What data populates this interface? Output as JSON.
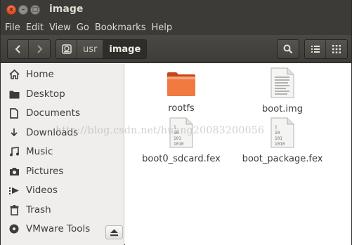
{
  "window": {
    "title": "image"
  },
  "menu": [
    "File",
    "Edit",
    "View",
    "Go",
    "Bookmarks",
    "Help"
  ],
  "breadcrumb": {
    "parent": "usr",
    "current": "image"
  },
  "sidebar": {
    "items": [
      {
        "label": "Home",
        "icon": "home-icon"
      },
      {
        "label": "Desktop",
        "icon": "folder-icon"
      },
      {
        "label": "Documents",
        "icon": "document-icon"
      },
      {
        "label": "Downloads",
        "icon": "download-icon"
      },
      {
        "label": "Music",
        "icon": "music-icon"
      },
      {
        "label": "Pictures",
        "icon": "camera-icon"
      },
      {
        "label": "Videos",
        "icon": "video-icon"
      },
      {
        "label": "Trash",
        "icon": "trash-icon"
      },
      {
        "label": "VMware Tools",
        "icon": "disc-icon"
      }
    ]
  },
  "files": [
    {
      "name": "rootfs",
      "type": "folder"
    },
    {
      "name": "boot.img",
      "type": "text-file"
    },
    {
      "name": "boot0_sdcard.fex",
      "type": "binary-file",
      "glyph": "1\n10\n101\n1010"
    },
    {
      "name": "boot_package.fex",
      "type": "binary-file",
      "glyph": "1\n10\n101\n1010"
    }
  ],
  "watermark": "http://blog.csdn.net/huang20083200056",
  "colors": {
    "titlebar": "#3c3b37",
    "close": "#e0471c",
    "folder": "#e8642c",
    "sidebar": "#efeeec"
  }
}
